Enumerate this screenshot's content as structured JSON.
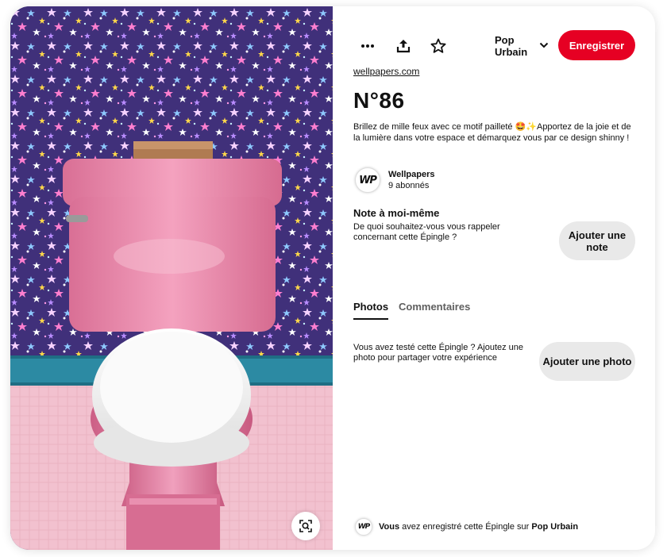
{
  "toolbar": {
    "more_icon": "ellipsis-icon",
    "share_icon": "share-upload-icon",
    "favorite_icon": "star-outline-icon",
    "board_name": "Pop Urbain",
    "save_label": "Enregistrer",
    "save_color": "#e60023"
  },
  "pin": {
    "source": "wellpapers.com",
    "title": "N°86",
    "description": "Brillez de mille feux avec ce motif pailleté 🤩✨Apportez de la joie et de la lumière dans votre espace et démarquez vous par ce design shinny !"
  },
  "creator": {
    "avatar_text": "WP",
    "name": "Wellpapers",
    "followers": "9 abonnés"
  },
  "note": {
    "title": "Note à moi-même",
    "text": "De quoi souhaitez-vous vous rappeler concernant cette Épingle ?",
    "button_label": "Ajouter une note"
  },
  "tabs": {
    "photos": "Photos",
    "comments": "Commentaires"
  },
  "photos": {
    "text": "Vous avez testé cette Épingle ? Ajoutez une photo pour partager votre expérience",
    "button_label": "Ajouter une photo"
  },
  "footer": {
    "avatar_text": "WP",
    "user": "Vous",
    "middle": " avez enregistré cette Épingle sur ",
    "board": "Pop Urbain"
  },
  "image": {
    "lens_icon": "visual-search-icon"
  }
}
